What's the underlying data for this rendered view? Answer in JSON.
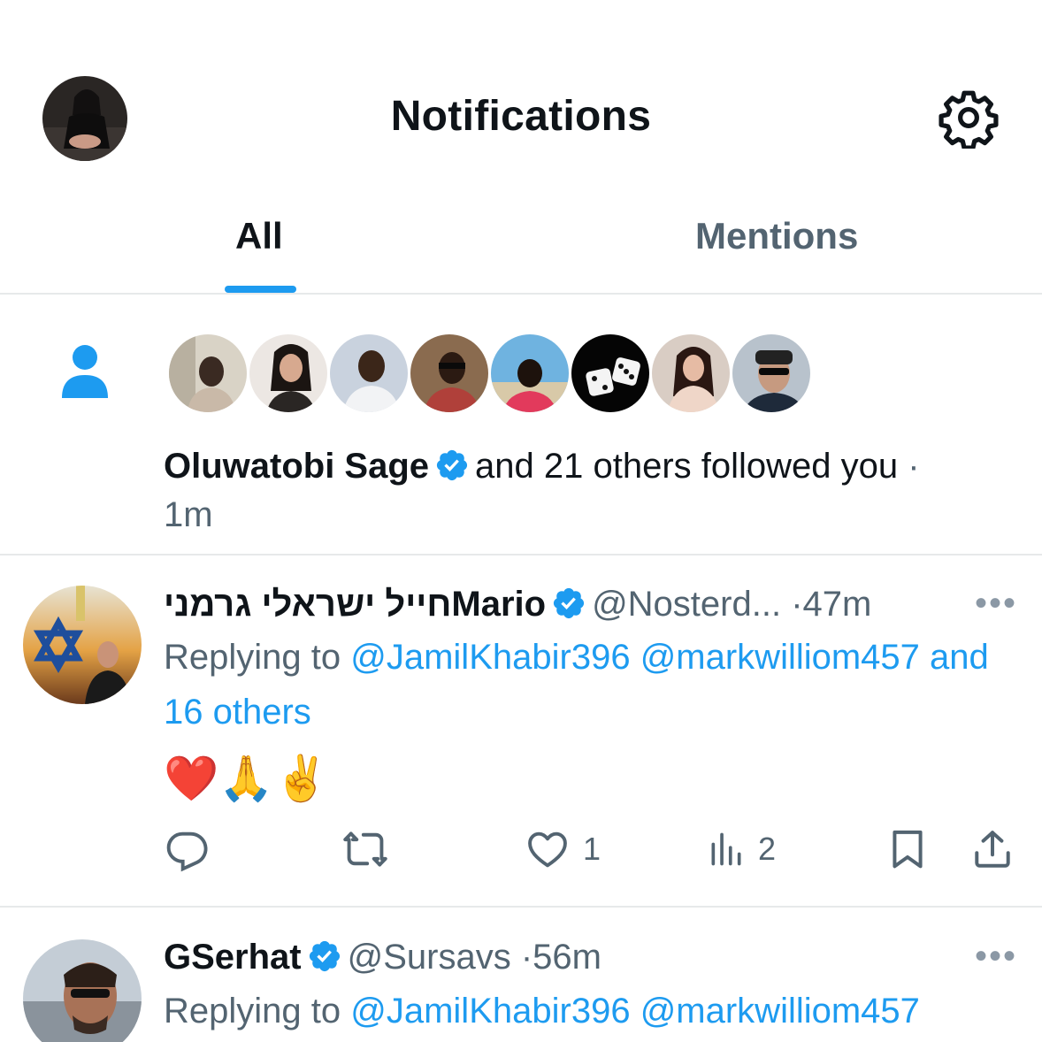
{
  "header": {
    "title": "Notifications",
    "avatar_icon": "profile-avatar",
    "settings_icon": "gear-icon"
  },
  "tabs": [
    {
      "label": "All",
      "active": true
    },
    {
      "label": "Mentions",
      "active": false
    }
  ],
  "follow_notification": {
    "icon": "person-icon",
    "name": "Oluwatobi Sage",
    "verified": true,
    "text": "and 21 others followed you",
    "separator": "·",
    "time": "1m",
    "avatar_count": 8
  },
  "tweets": [
    {
      "name": "חייל ישראלי גרמניMario",
      "verified": true,
      "handle": "@Nosterd...",
      "separator": "·",
      "time": "47m",
      "more": "•••",
      "replying_prefix": "Replying to",
      "mentions": [
        "@JamilKhabir396",
        "@markwilliom457"
      ],
      "mentions_more": "and 16 others",
      "body": "❤️🙏✌️",
      "actions": {
        "reply_count": "",
        "retweet_count": "",
        "like_count": "1",
        "views_count": "2"
      }
    },
    {
      "name": "GSerhat",
      "verified": true,
      "handle": "@Sursavs",
      "separator": "·",
      "time": "56m",
      "more": "•••",
      "replying_prefix": "Replying to",
      "mentions": [
        "@JamilKhabir396",
        "@markwilliom457"
      ]
    }
  ],
  "colors": {
    "accent": "#1d9bf0",
    "text_primary": "#0f1419",
    "text_secondary": "#536471",
    "divider": "#e7e9ea"
  }
}
